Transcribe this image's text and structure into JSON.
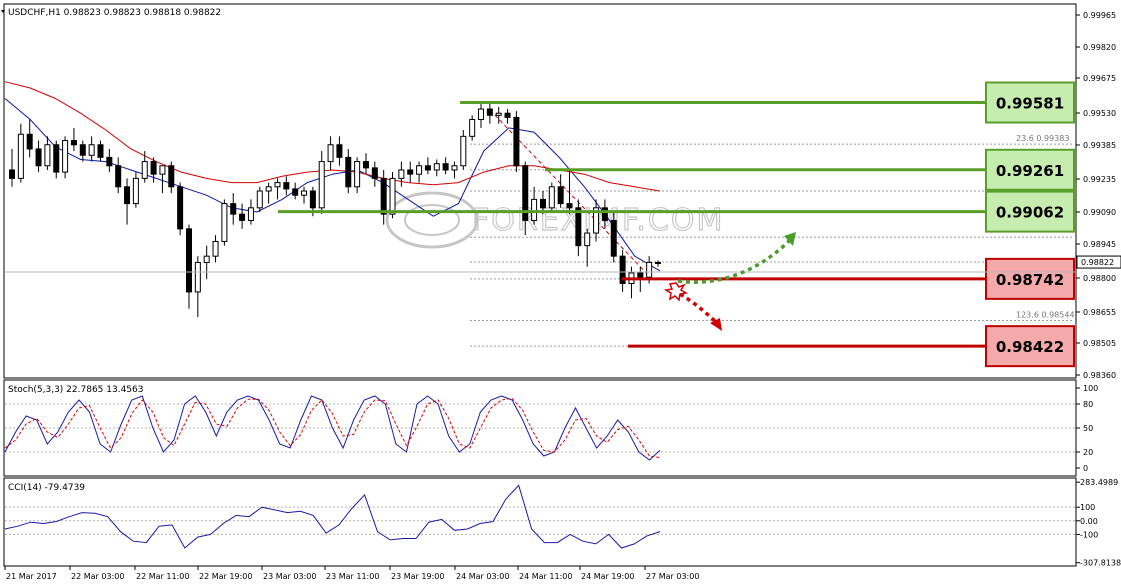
{
  "chart_data": [
    {
      "type": "candlestick",
      "title": "USDCHF,H1 0.98823 0.98823 0.98818 0.98822",
      "ylim": [
        0.9828,
        1.0004
      ],
      "y_ticks": [
        "0.99965",
        "0.99820",
        "0.99675",
        "0.99530",
        "0.99385",
        "0.99235",
        "0.99090",
        "0.98945",
        "0.98800",
        "0.98655",
        "0.98505",
        "0.98360"
      ],
      "current_price": "0.98822",
      "x_ticks": [
        "21 Mar 2017",
        "22 Mar 03:00",
        "22 Mar 11:00",
        "22 Mar 19:00",
        "23 Mar 03:00",
        "23 Mar 11:00",
        "23 Mar 19:00",
        "24 Mar 03:00",
        "24 Mar 11:00",
        "24 Mar 19:00",
        "27 Mar 03:00"
      ],
      "candles": [
        [
          0.9926,
          0.9936,
          0.9918,
          0.9922
        ],
        [
          0.9922,
          0.9948,
          0.992,
          0.9943
        ],
        [
          0.9943,
          0.995,
          0.9932,
          0.9936
        ],
        [
          0.9936,
          0.994,
          0.9925,
          0.9928
        ],
        [
          0.9928,
          0.9942,
          0.9926,
          0.9938
        ],
        [
          0.9938,
          0.994,
          0.9922,
          0.9925
        ],
        [
          0.9925,
          0.9942,
          0.9922,
          0.994
        ],
        [
          0.994,
          0.9946,
          0.9935,
          0.9938
        ],
        [
          0.9938,
          0.994,
          0.993,
          0.9933
        ],
        [
          0.9933,
          0.9942,
          0.993,
          0.9938
        ],
        [
          0.9938,
          0.994,
          0.993,
          0.9932
        ],
        [
          0.9932,
          0.9936,
          0.9925,
          0.9928
        ],
        [
          0.9928,
          0.9932,
          0.9915,
          0.9918
        ],
        [
          0.9918,
          0.9922,
          0.99,
          0.991
        ],
        [
          0.991,
          0.9925,
          0.9908,
          0.9922
        ],
        [
          0.9922,
          0.9935,
          0.992,
          0.993
        ],
        [
          0.993,
          0.9932,
          0.992,
          0.9924
        ],
        [
          0.9924,
          0.9928,
          0.9915,
          0.9928
        ],
        [
          0.9928,
          0.993,
          0.9915,
          0.9918
        ],
        [
          0.9918,
          0.992,
          0.9895,
          0.9898
        ],
        [
          0.9898,
          0.99,
          0.986,
          0.9868
        ],
        [
          0.9868,
          0.9885,
          0.9856,
          0.9882
        ],
        [
          0.9882,
          0.989,
          0.9874,
          0.9885
        ],
        [
          0.9885,
          0.9895,
          0.9882,
          0.9892
        ],
        [
          0.9892,
          0.9912,
          0.989,
          0.991
        ],
        [
          0.991,
          0.9915,
          0.99,
          0.9905
        ],
        [
          0.9905,
          0.991,
          0.9898,
          0.9902
        ],
        [
          0.9902,
          0.9912,
          0.99,
          0.9908
        ],
        [
          0.9908,
          0.9918,
          0.9906,
          0.9916
        ],
        [
          0.9916,
          0.992,
          0.991,
          0.9918
        ],
        [
          0.9918,
          0.9922,
          0.9912,
          0.992
        ],
        [
          0.992,
          0.9923,
          0.9914,
          0.9917
        ],
        [
          0.9917,
          0.992,
          0.9912,
          0.9914
        ],
        [
          0.9914,
          0.9918,
          0.991,
          0.9916
        ],
        [
          0.9916,
          0.9918,
          0.9904,
          0.9908
        ],
        [
          0.9908,
          0.9935,
          0.9905,
          0.993
        ],
        [
          0.993,
          0.9942,
          0.9926,
          0.9938
        ],
        [
          0.9938,
          0.9942,
          0.9928,
          0.9932
        ],
        [
          0.9932,
          0.9936,
          0.9915,
          0.9918
        ],
        [
          0.9918,
          0.9932,
          0.9915,
          0.993
        ],
        [
          0.993,
          0.9934,
          0.9924,
          0.9927
        ],
        [
          0.9927,
          0.993,
          0.9918,
          0.9922
        ],
        [
          0.9922,
          0.9926,
          0.99,
          0.9905
        ],
        [
          0.9905,
          0.9925,
          0.9903,
          0.9922
        ],
        [
          0.9922,
          0.993,
          0.9918,
          0.9926
        ],
        [
          0.9926,
          0.993,
          0.992,
          0.9924
        ],
        [
          0.9924,
          0.993,
          0.992,
          0.9928
        ],
        [
          0.9928,
          0.9932,
          0.9924,
          0.9926
        ],
        [
          0.9926,
          0.9931,
          0.9923,
          0.9929
        ],
        [
          0.9929,
          0.9932,
          0.9924,
          0.9926
        ],
        [
          0.9926,
          0.993,
          0.9922,
          0.9928
        ],
        [
          0.9928,
          0.9945,
          0.9926,
          0.9942
        ],
        [
          0.9942,
          0.9952,
          0.994,
          0.995
        ],
        [
          0.995,
          0.9958,
          0.9946,
          0.9955
        ],
        [
          0.9955,
          0.9958,
          0.9948,
          0.9952
        ],
        [
          0.9952,
          0.9956,
          0.9948,
          0.9953
        ],
        [
          0.9953,
          0.9955,
          0.9948,
          0.9951
        ],
        [
          0.9951,
          0.9954,
          0.9925,
          0.9928
        ],
        [
          0.9928,
          0.993,
          0.9895,
          0.9902
        ],
        [
          0.9902,
          0.9918,
          0.99,
          0.9912
        ],
        [
          0.9912,
          0.9916,
          0.9905,
          0.9908
        ],
        [
          0.9908,
          0.992,
          0.9906,
          0.9918
        ],
        [
          0.9918,
          0.9924,
          0.9908,
          0.991
        ],
        [
          0.991,
          0.9926,
          0.9905,
          0.9908
        ],
        [
          0.9908,
          0.9912,
          0.9885,
          0.989
        ],
        [
          0.989,
          0.9898,
          0.988,
          0.9896
        ],
        [
          0.9896,
          0.9912,
          0.9892,
          0.9908
        ],
        [
          0.9908,
          0.9912,
          0.9898,
          0.9902
        ],
        [
          0.9902,
          0.9906,
          0.9882,
          0.9885
        ],
        [
          0.9885,
          0.9888,
          0.9868,
          0.9872
        ],
        [
          0.9872,
          0.988,
          0.9865,
          0.9877
        ],
        [
          0.9877,
          0.988,
          0.9868,
          0.9875
        ],
        [
          0.9875,
          0.9885,
          0.9872,
          0.9882
        ],
        [
          0.9882,
          0.9883,
          0.988,
          0.9882
        ]
      ],
      "moving_averages": [
        {
          "color": "#0a1aa8",
          "values": [
            0.996,
            0.995,
            0.9937,
            0.9931,
            0.993,
            0.9926,
            0.9922,
            0.9918,
            0.9914,
            0.9908,
            0.9906,
            0.9912,
            0.992,
            0.9924,
            0.9926,
            0.992,
            0.9912,
            0.9904,
            0.991,
            0.9935,
            0.9946,
            0.9944,
            0.9932,
            0.9918,
            0.9902,
            0.9885,
            0.9878
          ]
        },
        {
          "color": "#d00000",
          "values": [
            0.9968,
            0.9965,
            0.996,
            0.9953,
            0.9945,
            0.9936,
            0.993,
            0.9925,
            0.9922,
            0.992,
            0.992,
            0.9923,
            0.9925,
            0.9926,
            0.9925,
            0.9922,
            0.992,
            0.9919,
            0.992,
            0.9925,
            0.9928,
            0.9928,
            0.9926,
            0.9924,
            0.992,
            0.9918,
            0.9916
          ]
        }
      ],
      "levels": [
        {
          "value": "0.99581",
          "price": 0.99581,
          "kind": "resistance",
          "color": "#5a9e2a",
          "fill": "#c6ecb0"
        },
        {
          "value": "0.99261",
          "price": 0.99261,
          "kind": "resistance",
          "color": "#5a9e2a",
          "fill": "#c6ecb0"
        },
        {
          "value": "0.99062",
          "price": 0.99062,
          "kind": "resistance",
          "color": "#5a9e2a",
          "fill": "#c6ecb0"
        },
        {
          "value": "0.98742",
          "price": 0.98742,
          "kind": "support",
          "color": "#c00000",
          "fill": "#f4aaaa"
        },
        {
          "value": "0.98422",
          "price": 0.98422,
          "kind": "support",
          "color": "#c00000",
          "fill": "#f4aaaa"
        }
      ],
      "fibo_labels": [
        {
          "text": "23.6  0.99383",
          "price": 0.99383
        },
        {
          "text": "123.6  0.98544",
          "price": 0.98544
        }
      ],
      "fibo_dotted_prices": [
        0.99383,
        0.99261,
        0.9916,
        0.99062,
        0.9894,
        0.98822,
        0.98742,
        0.98544,
        0.98422
      ],
      "watermark": "FOREXIMF.COM",
      "bullish_arrow_color": "#4a9e2a",
      "bearish_arrow_color": "#d00000"
    },
    {
      "type": "line",
      "title": "Stoch(5,3,3) 22.7865 13.4563",
      "ylim": [
        -5,
        105
      ],
      "y_ticks": [
        "100",
        "80",
        "50",
        "20",
        "0"
      ],
      "series": [
        {
          "color": "#1a1aa8",
          "values": [
            20,
            45,
            65,
            60,
            30,
            45,
            70,
            85,
            70,
            30,
            20,
            55,
            85,
            90,
            50,
            20,
            35,
            80,
            90,
            70,
            40,
            70,
            85,
            90,
            85,
            60,
            30,
            25,
            60,
            90,
            85,
            50,
            25,
            60,
            85,
            90,
            80,
            30,
            20,
            80,
            90,
            80,
            40,
            20,
            30,
            70,
            85,
            90,
            85,
            60,
            30,
            15,
            20,
            50,
            75,
            50,
            25,
            40,
            60,
            45,
            20,
            10,
            22
          ]
        },
        {
          "color": "#e00000",
          "values": [
            25,
            35,
            55,
            62,
            45,
            38,
            55,
            75,
            78,
            50,
            25,
            38,
            68,
            85,
            70,
            38,
            28,
            55,
            82,
            80,
            55,
            52,
            75,
            86,
            86,
            72,
            45,
            28,
            42,
            72,
            85,
            68,
            40,
            42,
            70,
            85,
            84,
            55,
            28,
            52,
            80,
            85,
            62,
            30,
            25,
            50,
            75,
            85,
            87,
            72,
            45,
            22,
            20,
            35,
            60,
            62,
            40,
            32,
            48,
            52,
            35,
            15,
            13
          ]
        }
      ]
    },
    {
      "type": "line",
      "title": "CCI(14) -79.4739",
      "ylim": [
        -310,
        285
      ],
      "y_ticks": [
        "283.4989",
        "100",
        "0.00",
        "-100",
        "-307.8138"
      ],
      "series": [
        {
          "color": "#1a1aa8",
          "values": [
            -60,
            -40,
            -10,
            -20,
            -5,
            30,
            60,
            55,
            30,
            -80,
            -150,
            -160,
            -40,
            -30,
            -200,
            -120,
            -100,
            -20,
            40,
            30,
            100,
            80,
            60,
            70,
            40,
            -90,
            -30,
            90,
            190,
            -80,
            -140,
            -130,
            -130,
            -10,
            10,
            -70,
            -60,
            -20,
            -5,
            160,
            260,
            -60,
            -160,
            -160,
            -100,
            -150,
            -170,
            -100,
            -200,
            -170,
            -110,
            -79
          ]
        }
      ]
    }
  ]
}
